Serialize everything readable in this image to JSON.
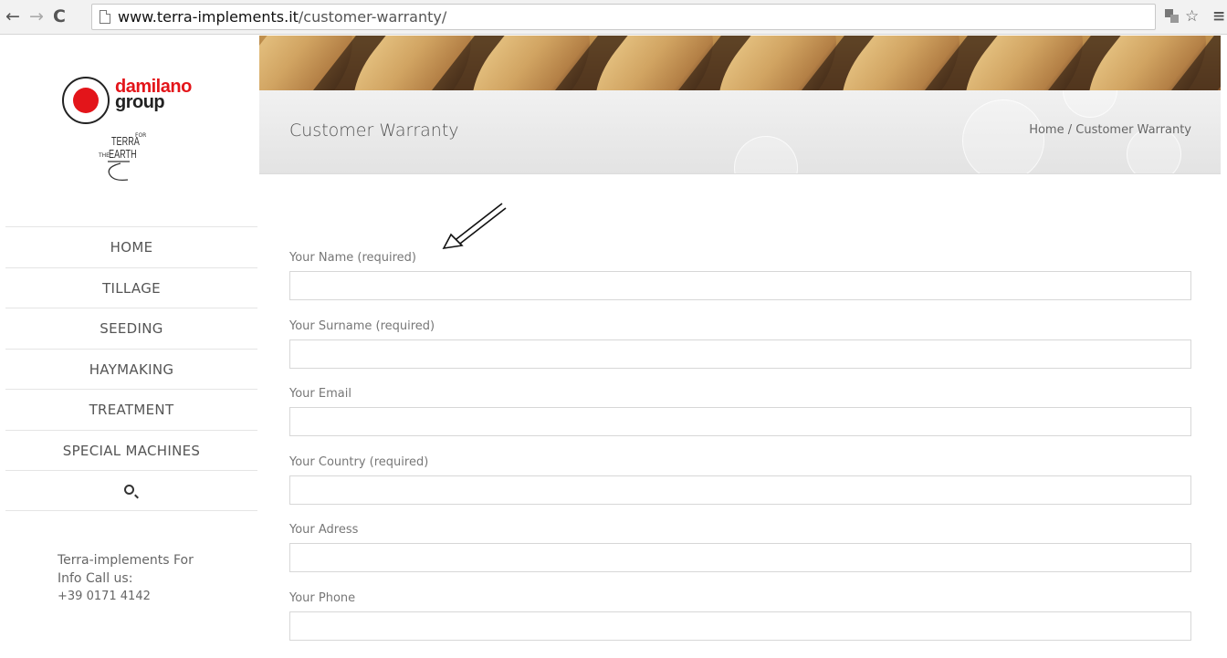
{
  "browser": {
    "url_host": "www.terra-implements.it",
    "url_path": "/customer-warranty/",
    "back_icon": "←",
    "forward_icon": "→",
    "reload_icon": "C",
    "star_icon": "☆",
    "menu_icon": "≡"
  },
  "sidebar": {
    "logo_line1": "damilano",
    "logo_line2": "group",
    "terra_logo": {
      "terra": "TERRA",
      "for": "FOR",
      "the": "THE",
      "earth": "EARTH"
    },
    "menu": [
      {
        "label": "HOME"
      },
      {
        "label": "TILLAGE"
      },
      {
        "label": "SEEDING"
      },
      {
        "label": "HAYMAKING"
      },
      {
        "label": "TREATMENT"
      },
      {
        "label": "SPECIAL MACHINES"
      }
    ],
    "info_line1": "Terra-implements For",
    "info_line2": "Info Call us:",
    "info_phone": "+39 0171 4142"
  },
  "header": {
    "title": "Customer Warranty",
    "breadcrumb_home": "Home",
    "breadcrumb_sep": "/",
    "breadcrumb_current": "Customer Warranty"
  },
  "form": {
    "fields": [
      {
        "label": "Your Name (required)",
        "value": ""
      },
      {
        "label": "Your Surname (required)",
        "value": ""
      },
      {
        "label": "Your Email",
        "value": ""
      },
      {
        "label": "Your Country (required)",
        "value": ""
      },
      {
        "label": "Your Adress",
        "value": ""
      },
      {
        "label": "Your Phone",
        "value": ""
      }
    ]
  },
  "colors": {
    "brand_red": "#e3151a",
    "text": "#555555",
    "border": "#d7d7d7"
  }
}
